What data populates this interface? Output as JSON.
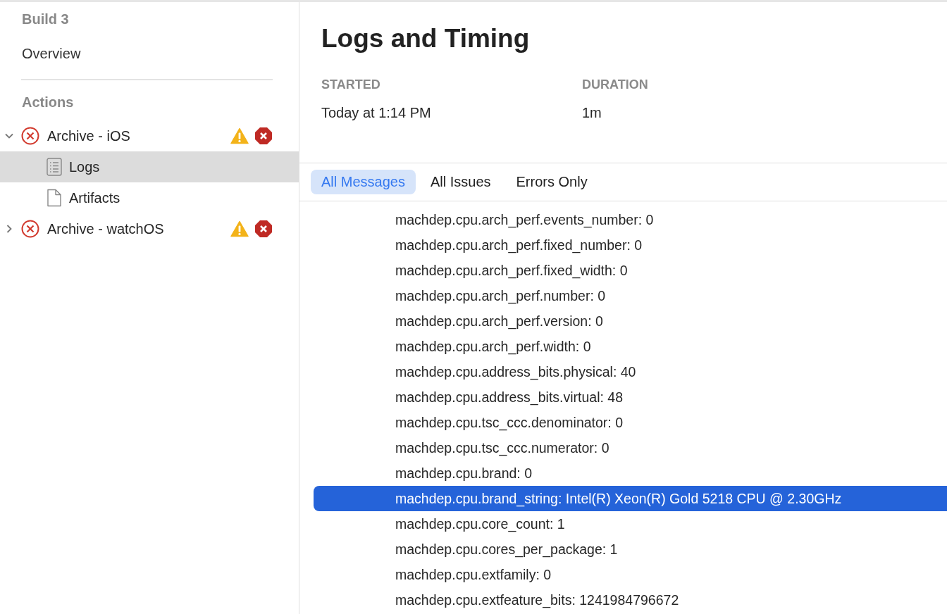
{
  "sidebar": {
    "header": "Build 3",
    "overview": "Overview",
    "section": "Actions",
    "actions": [
      {
        "label": "Archive - iOS",
        "expanded": true,
        "failed": true,
        "has_warnings": true,
        "has_errors": true,
        "children": [
          {
            "label": "Logs",
            "kind": "log",
            "selected": true
          },
          {
            "label": "Artifacts",
            "kind": "file",
            "selected": false
          }
        ]
      },
      {
        "label": "Archive - watchOS",
        "expanded": false,
        "failed": true,
        "has_warnings": true,
        "has_errors": true
      }
    ]
  },
  "main": {
    "title": "Logs and Timing",
    "fields": [
      {
        "label": "STARTED",
        "value": "Today at 1:14 PM"
      },
      {
        "label": "DURATION",
        "value": "1m"
      }
    ],
    "tabs": [
      {
        "label": "All Messages",
        "selected": true
      },
      {
        "label": "All Issues",
        "selected": false
      },
      {
        "label": "Errors Only",
        "selected": false
      }
    ],
    "log_lines": [
      {
        "text": "machdep.cpu.arch_perf.events_number: 0",
        "selected": false
      },
      {
        "text": "machdep.cpu.arch_perf.fixed_number: 0",
        "selected": false
      },
      {
        "text": "machdep.cpu.arch_perf.fixed_width: 0",
        "selected": false
      },
      {
        "text": "machdep.cpu.arch_perf.number: 0",
        "selected": false
      },
      {
        "text": "machdep.cpu.arch_perf.version: 0",
        "selected": false
      },
      {
        "text": "machdep.cpu.arch_perf.width: 0",
        "selected": false
      },
      {
        "text": "machdep.cpu.address_bits.physical: 40",
        "selected": false
      },
      {
        "text": "machdep.cpu.address_bits.virtual: 48",
        "selected": false
      },
      {
        "text": "machdep.cpu.tsc_ccc.denominator: 0",
        "selected": false
      },
      {
        "text": "machdep.cpu.tsc_ccc.numerator: 0",
        "selected": false
      },
      {
        "text": "machdep.cpu.brand: 0",
        "selected": false
      },
      {
        "text": "machdep.cpu.brand_string: Intel(R) Xeon(R) Gold 5218 CPU @ 2.30GHz",
        "selected": true
      },
      {
        "text": "machdep.cpu.core_count: 1",
        "selected": false
      },
      {
        "text": "machdep.cpu.cores_per_package: 1",
        "selected": false
      },
      {
        "text": "machdep.cpu.extfamily: 0",
        "selected": false
      },
      {
        "text": "machdep.cpu.extfeature_bits: 1241984796672",
        "selected": false
      }
    ]
  }
}
